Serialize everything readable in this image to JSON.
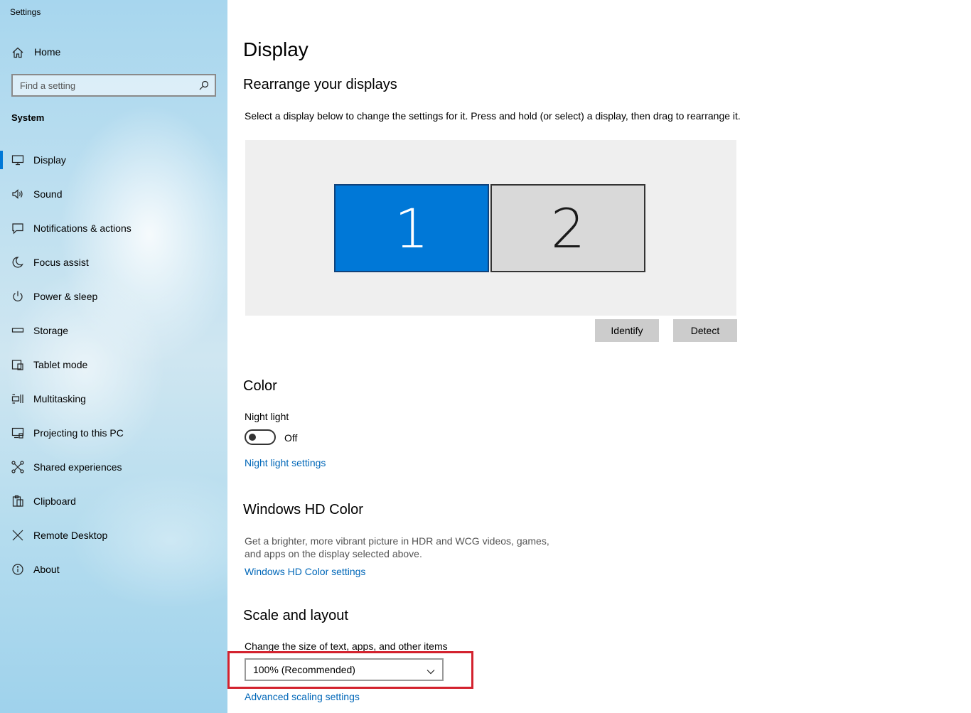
{
  "window": {
    "title": "Settings"
  },
  "sidebar": {
    "home_label": "Home",
    "search": {
      "placeholder": "Find a setting",
      "value": ""
    },
    "section_label": "System",
    "items": [
      {
        "label": "Display",
        "icon": "monitor-icon",
        "active": true
      },
      {
        "label": "Sound",
        "icon": "speaker-icon"
      },
      {
        "label": "Notifications & actions",
        "icon": "notification-icon"
      },
      {
        "label": "Focus assist",
        "icon": "moon-icon"
      },
      {
        "label": "Power & sleep",
        "icon": "power-icon"
      },
      {
        "label": "Storage",
        "icon": "storage-icon"
      },
      {
        "label": "Tablet mode",
        "icon": "tablet-icon"
      },
      {
        "label": "Multitasking",
        "icon": "multitasking-icon"
      },
      {
        "label": "Projecting to this PC",
        "icon": "projecting-icon"
      },
      {
        "label": "Shared experiences",
        "icon": "shared-experiences-icon"
      },
      {
        "label": "Clipboard",
        "icon": "clipboard-icon"
      },
      {
        "label": "Remote Desktop",
        "icon": "remote-desktop-icon"
      },
      {
        "label": "About",
        "icon": "info-icon"
      }
    ]
  },
  "main": {
    "title": "Display",
    "rearrange": {
      "heading": "Rearrange your displays",
      "description": "Select a display below to change the settings for it. Press and hold (or select) a display, then drag to rearrange it.",
      "displays": [
        {
          "label": "1",
          "selected": true
        },
        {
          "label": "2",
          "selected": false
        }
      ],
      "identify_label": "Identify",
      "detect_label": "Detect"
    },
    "color": {
      "heading": "Color",
      "night_light_label": "Night light",
      "night_light_state": "Off",
      "night_light_settings_link": "Night light settings"
    },
    "hd_color": {
      "heading": "Windows HD Color",
      "description_line1": "Get a brighter, more vibrant picture in HDR and WCG videos, games,",
      "description_line2": "and apps on the display selected above.",
      "settings_link": "Windows HD Color settings"
    },
    "scale": {
      "heading": "Scale and layout",
      "size_label": "Change the size of text, apps, and other items",
      "size_value": "100% (Recommended)",
      "advanced_link": "Advanced scaling settings"
    }
  },
  "colors": {
    "accent": "#0078d7",
    "link": "#0067b8",
    "highlight_box": "#d3222e"
  }
}
